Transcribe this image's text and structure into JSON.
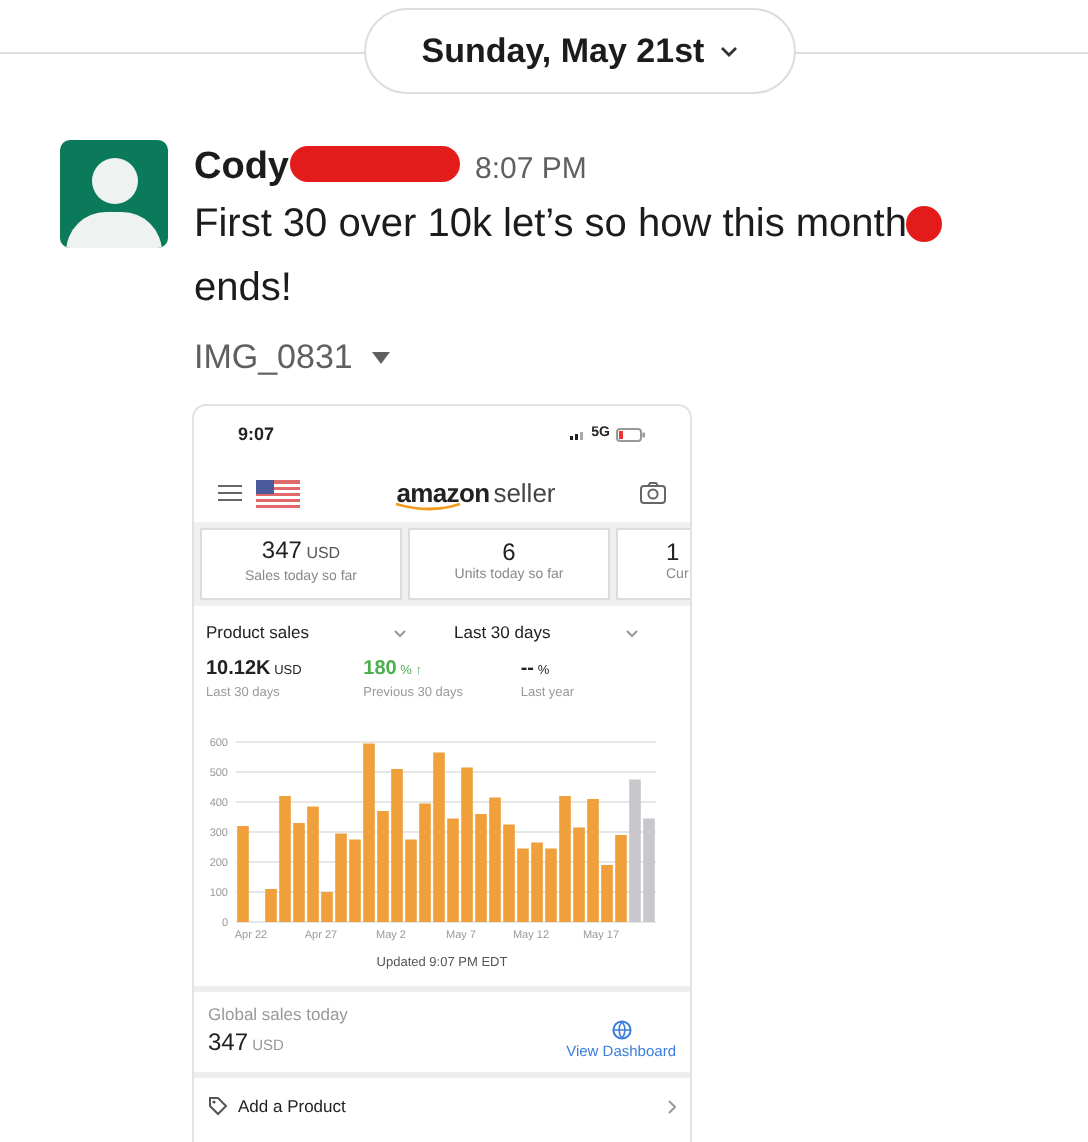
{
  "date_divider": {
    "label": "Sunday, May 21st"
  },
  "message": {
    "author": "Cody",
    "time": "8:07 PM",
    "text": "First 30 over 10k let’s so how this month",
    "text_end": "ends!",
    "attachment": "IMG_0831"
  },
  "screenshot": {
    "status_time": "9:07",
    "network": "5G",
    "logo_word": "amazon",
    "logo_suffix": "seller",
    "stats": [
      {
        "value": "347",
        "unit": "USD",
        "label": "Sales today so far",
        "kind": "full"
      },
      {
        "value": "6",
        "label": "Units today so far",
        "kind": "full"
      },
      {
        "value": "1",
        "label": "Cur",
        "kind": "cut"
      }
    ],
    "metric_select": "Product sales",
    "period_select": "Last 30 days",
    "metrics": [
      {
        "value": "10.12K",
        "unit": "USD",
        "label": "Last 30 days",
        "kind": "plain"
      },
      {
        "value": "180",
        "unit": "%",
        "change": "↑",
        "label": "Previous 30 days",
        "kind": "positive"
      },
      {
        "value": "--",
        "unit": "%",
        "label": "Last year",
        "kind": "plain"
      }
    ],
    "chart_data": {
      "type": "bar",
      "grid": true,
      "categories": [
        "Apr 22",
        null,
        null,
        null,
        null,
        "Apr 27",
        null,
        null,
        null,
        null,
        "May 2",
        null,
        null,
        null,
        null,
        "May 7",
        null,
        null,
        null,
        null,
        "May 12",
        null,
        null,
        null,
        null,
        "May 17",
        null,
        null,
        null,
        null
      ],
      "yticks": [
        0,
        100,
        200,
        300,
        400,
        500,
        600
      ],
      "ylim": [
        0,
        600
      ],
      "series": [
        {
          "color": "#f0a03a",
          "values": [
            320,
            0,
            110,
            420,
            330,
            385,
            100,
            295,
            275,
            595,
            370,
            510,
            275,
            395,
            565,
            345,
            515,
            360,
            415,
            325,
            245,
            265,
            245,
            420,
            315,
            410,
            190,
            290,
            null,
            null
          ]
        },
        {
          "color": "#c8c8cc",
          "values": [
            null,
            null,
            null,
            null,
            null,
            null,
            null,
            null,
            null,
            null,
            null,
            null,
            null,
            null,
            null,
            null,
            null,
            null,
            null,
            null,
            null,
            null,
            null,
            null,
            null,
            null,
            null,
            null,
            475,
            345
          ]
        }
      ]
    },
    "updated": "Updated 9:07 PM EDT",
    "global_label": "Global sales today",
    "global_value": "347",
    "global_unit": "USD",
    "dashboard_link": "View Dashboard",
    "action": "Add a Product"
  }
}
